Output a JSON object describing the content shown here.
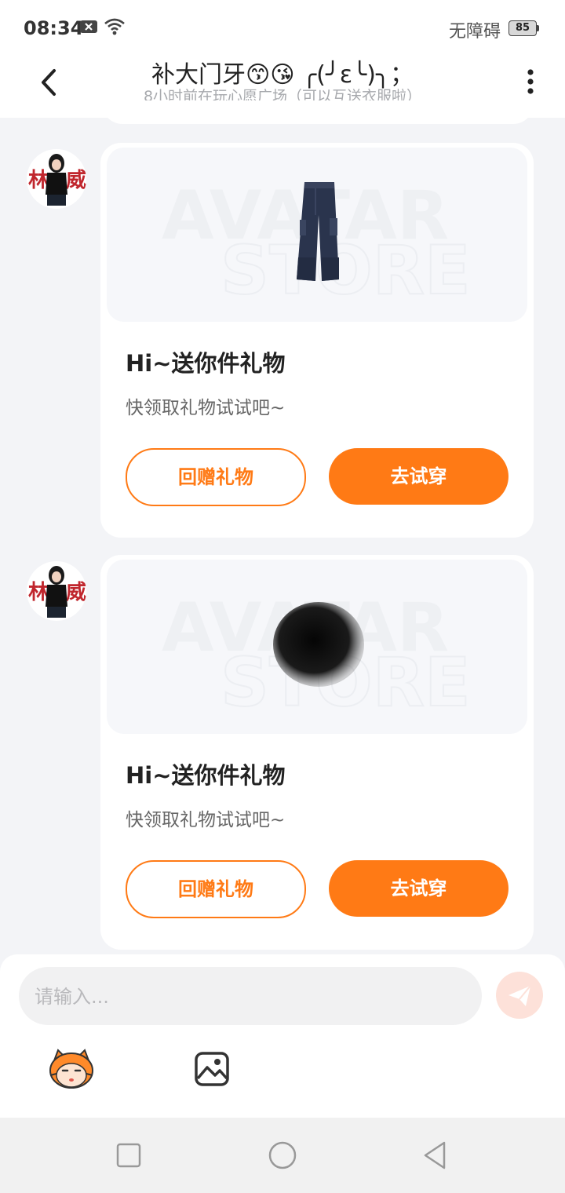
{
  "status_bar": {
    "time": "08:34",
    "accessibility": "无障碍",
    "battery": "85",
    "icons": [
      "notification-close-icon",
      "wifi-icon"
    ]
  },
  "header": {
    "title": "补大门牙😙😘 ╭(╯ε╰)╮；",
    "subtitle": "8小时前在玩心愿广场（可以互送衣服啦）",
    "back_icon": "chevron-left-icon",
    "more_icon": "more-vertical-icon"
  },
  "messages": [
    {
      "avatar": "user-avatar",
      "gift_item": "denim-cargo-jeans",
      "watermark": [
        "AVATAR",
        "STORE"
      ],
      "title": "Hi~送你件礼物",
      "desc": "快领取礼物试试吧~",
      "return_label": "回赠礼物",
      "try_label": "去试穿"
    },
    {
      "avatar": "user-avatar",
      "gift_item": "black-fluffy-hair",
      "watermark": [
        "AVATAR",
        "STORE"
      ],
      "title": "Hi~送你件礼物",
      "desc": "快领取礼物试试吧~",
      "return_label": "回赠礼物",
      "try_label": "去试穿"
    }
  ],
  "input": {
    "placeholder": "请输入...",
    "send_icon": "paper-plane-icon",
    "tools": [
      "mascot-emoji-icon",
      "image-gallery-icon"
    ]
  },
  "nav": [
    "square-recent-icon",
    "circle-home-icon",
    "triangle-back-icon"
  ],
  "colors": {
    "accent": "#ff7a15",
    "background": "#f3f4f7",
    "card": "#ffffff",
    "send_disabled": "#fde1d9"
  }
}
